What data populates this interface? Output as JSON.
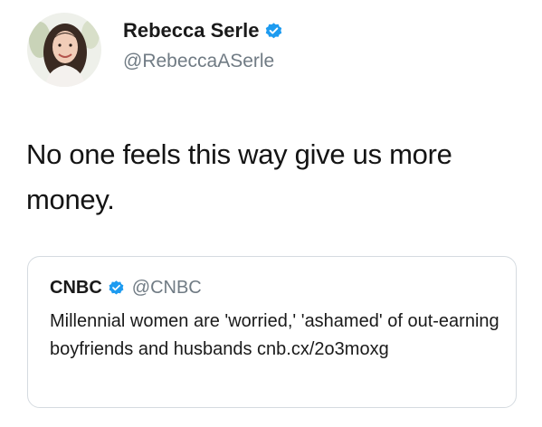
{
  "tweet": {
    "author_name": "Rebecca Serle",
    "author_handle": "@RebeccaASerle",
    "avatar_icon": "profile-photo",
    "verified_icon": "verified-badge-icon",
    "text": "No one feels this way give us more money."
  },
  "quoted_tweet": {
    "author_name": "CNBC",
    "author_handle": "@CNBC",
    "verified_icon": "verified-badge-icon",
    "text": "Millennial women are 'worried,' 'ashamed' of out-earning boyfriends and husbands cnb.cx/2o3moxg"
  },
  "colors": {
    "verified_blue": "#1d9bf0",
    "handle_gray": "#707b84",
    "border_gray": "#d5dbe0"
  }
}
